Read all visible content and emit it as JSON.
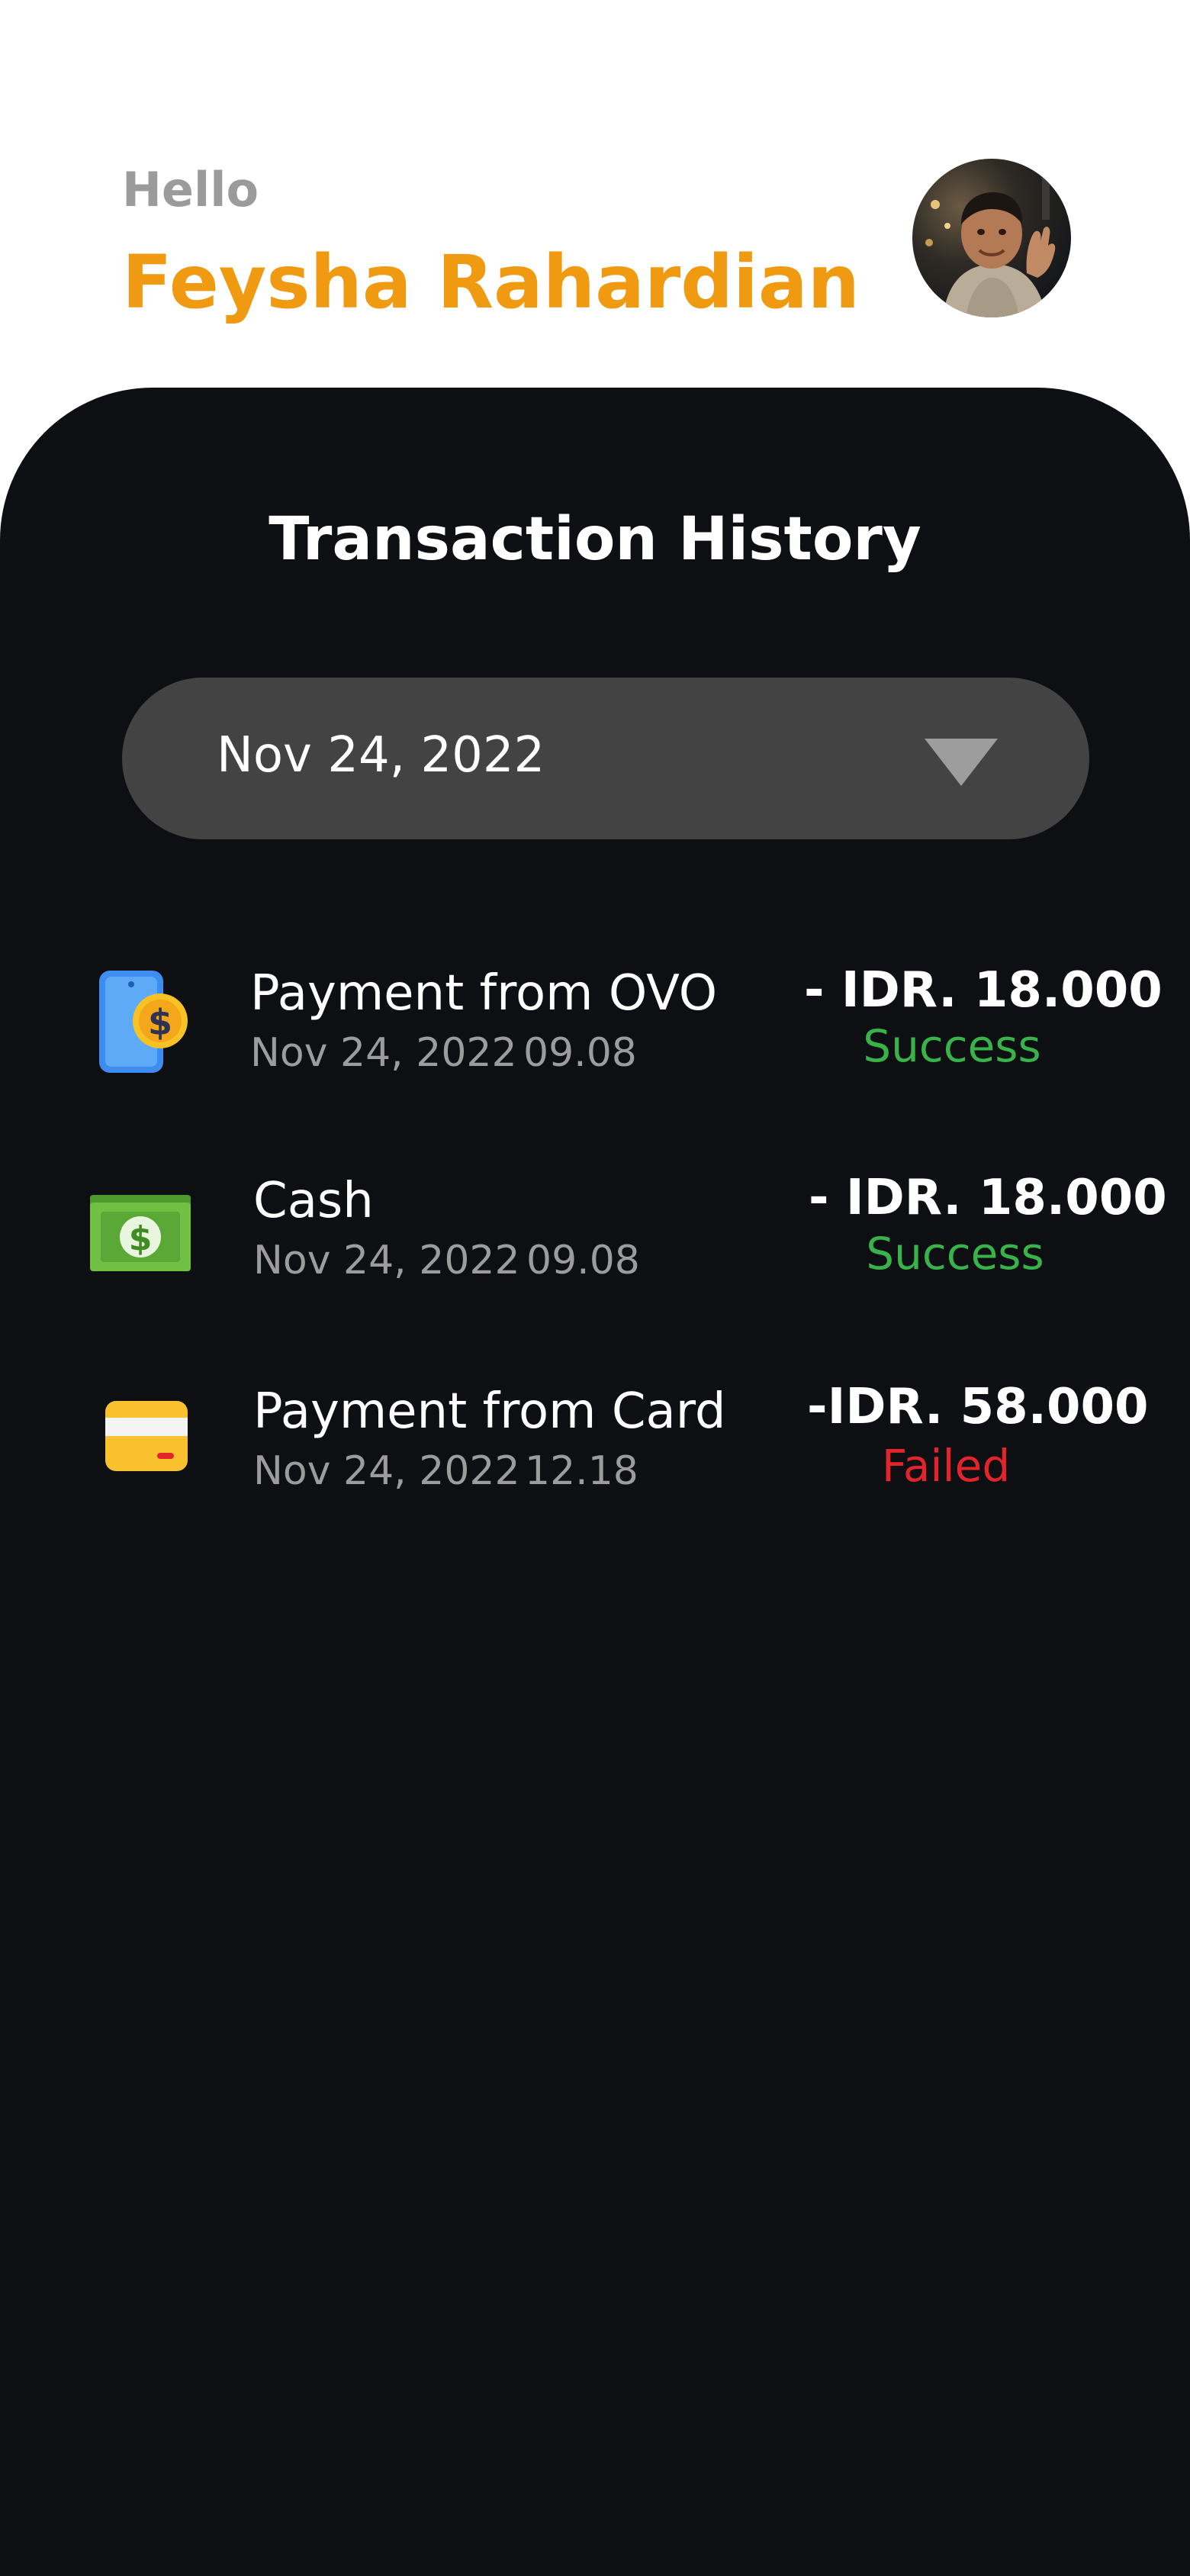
{
  "header": {
    "greeting": "Hello",
    "user_name": "Feysha Rahardian"
  },
  "panel": {
    "title": "Transaction History"
  },
  "date_filter": {
    "selected": "Nov 24, 2022"
  },
  "transactions": [
    {
      "icon": "mobile-payment-icon",
      "title": "Payment from OVO",
      "date": "Nov 24, 2022",
      "time": "09.08",
      "amount": "- IDR. 18.000",
      "status": "Success"
    },
    {
      "icon": "cash-icon",
      "title": "Cash",
      "date": "Nov 24, 2022",
      "time": "09.08",
      "amount": "- IDR. 18.000",
      "status": "Success"
    },
    {
      "icon": "card-icon",
      "title": "Payment from Card",
      "date": "Nov 24, 2022",
      "time": "12.18",
      "amount": "-IDR. 58.000",
      "status": "Failed"
    }
  ],
  "colors": {
    "accent": "#f09a12",
    "panel_bg": "#0d0f13",
    "select_bg": "#434343",
    "success": "#38b34a",
    "failed": "#e3242b"
  }
}
